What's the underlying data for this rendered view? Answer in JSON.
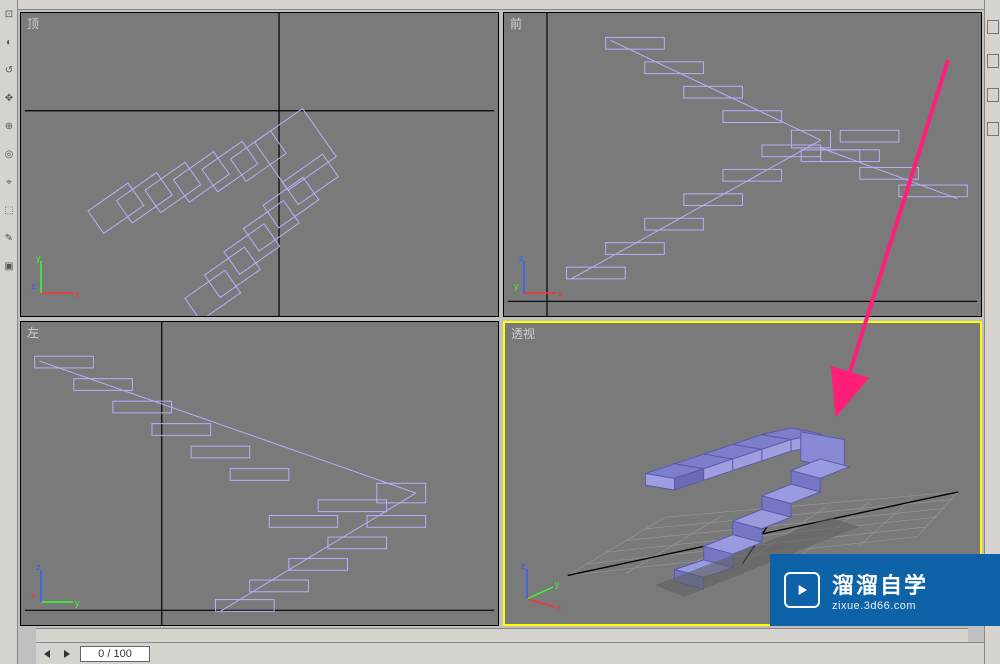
{
  "viewports": {
    "top": {
      "label": "顶"
    },
    "front": {
      "label": "前"
    },
    "left": {
      "label": "左"
    },
    "persp": {
      "label": "透视",
      "active": true
    }
  },
  "axes": {
    "x": "x",
    "y": "y",
    "z": "z"
  },
  "timeline": {
    "frame_display": "0 / 100"
  },
  "watermark": {
    "title": "溜溜自学",
    "subtitle": "zixue.3d66.com",
    "icon_name": "play-circle-icon"
  },
  "annotation": {
    "color": "#ff1e78"
  }
}
